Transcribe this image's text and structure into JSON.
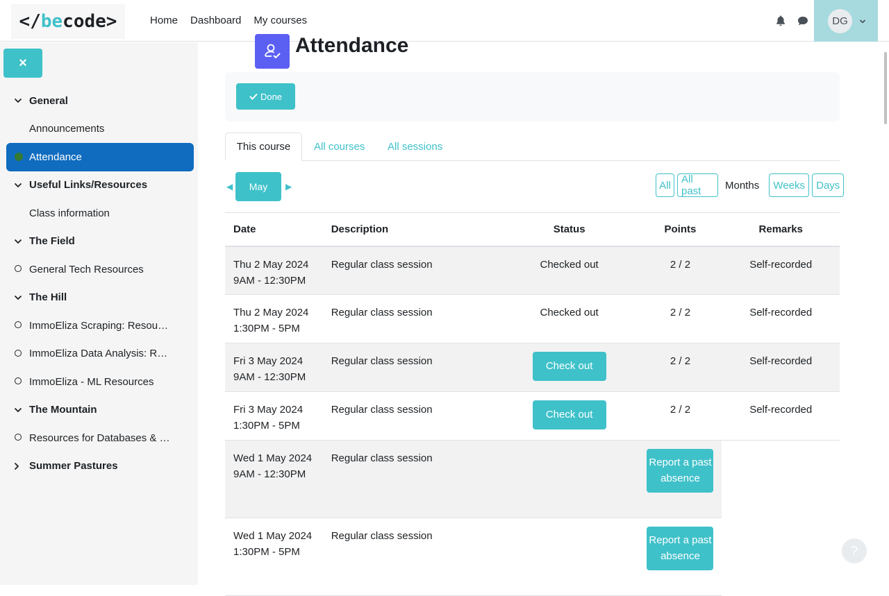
{
  "brand": {
    "logo_text": "</becode>"
  },
  "nav": {
    "links": [
      "Home",
      "Dashboard",
      "My courses"
    ],
    "user_initials": "DG"
  },
  "drawer": {
    "close_label": "×",
    "items": [
      {
        "type": "section",
        "label": "General",
        "expanded": true
      },
      {
        "type": "item",
        "label": "Announcements",
        "marker": "none"
      },
      {
        "type": "item",
        "label": "Attendance",
        "marker": "complete",
        "active": true
      },
      {
        "type": "section",
        "label": "Useful Links/Resources",
        "expanded": true
      },
      {
        "type": "item",
        "label": "Class information",
        "marker": "none"
      },
      {
        "type": "section",
        "label": "The Field",
        "expanded": true
      },
      {
        "type": "item",
        "label": "General Tech Resources",
        "marker": "circle"
      },
      {
        "type": "section",
        "label": "The Hill",
        "expanded": true
      },
      {
        "type": "item",
        "label": "ImmoEliza Scraping: Resources",
        "marker": "circle"
      },
      {
        "type": "item",
        "label": "ImmoEliza Data Analysis: Resources",
        "marker": "circle"
      },
      {
        "type": "item",
        "label": "ImmoEliza - ML Resources",
        "marker": "circle"
      },
      {
        "type": "section",
        "label": "The Mountain",
        "expanded": true
      },
      {
        "type": "item",
        "label": "Resources for Databases & SQL",
        "marker": "circle"
      },
      {
        "type": "section",
        "label": "Summer Pastures",
        "expanded": false
      }
    ]
  },
  "page": {
    "title": "Attendance",
    "done_label": "Done"
  },
  "tabs": [
    "This course",
    "All courses",
    "All sessions"
  ],
  "period": {
    "current": "May",
    "prev": "◀",
    "next": "▶"
  },
  "views": [
    "All",
    "All past",
    "Months",
    "Weeks",
    "Days"
  ],
  "table": {
    "headers": [
      "Date",
      "Description",
      "Status",
      "Points",
      "Remarks"
    ],
    "rows": [
      {
        "date": "Thu 2 May 2024",
        "time": "9AM - 12:30PM",
        "description": "Regular class session",
        "status": "Checked out",
        "points": "2 / 2",
        "remarks": "Self-recorded"
      },
      {
        "date": "Thu 2 May 2024",
        "time": "1:30PM - 5PM",
        "description": "Regular class session",
        "status": "Checked out",
        "points": "2 / 2",
        "remarks": "Self-recorded"
      },
      {
        "date": "Fri 3 May 2024",
        "time": "9AM - 12:30PM",
        "description": "Regular class session",
        "status_button": "Check out",
        "points": "2 / 2",
        "remarks": "Self-recorded"
      },
      {
        "date": "Fri 3 May 2024",
        "time": "1:30PM - 5PM",
        "description": "Regular class session",
        "status_button": "Check out",
        "points": "2 / 2",
        "remarks": "Self-recorded"
      },
      {
        "date": "Wed 1 May 2024",
        "time": "9AM - 12:30PM",
        "description": "Regular class session",
        "action_button": "Report a past absence"
      },
      {
        "date": "Wed 1 May 2024",
        "time": "1:30PM - 5PM",
        "description": "Regular class session",
        "action_button": "Report a past absence"
      }
    ]
  },
  "help_label": "?"
}
